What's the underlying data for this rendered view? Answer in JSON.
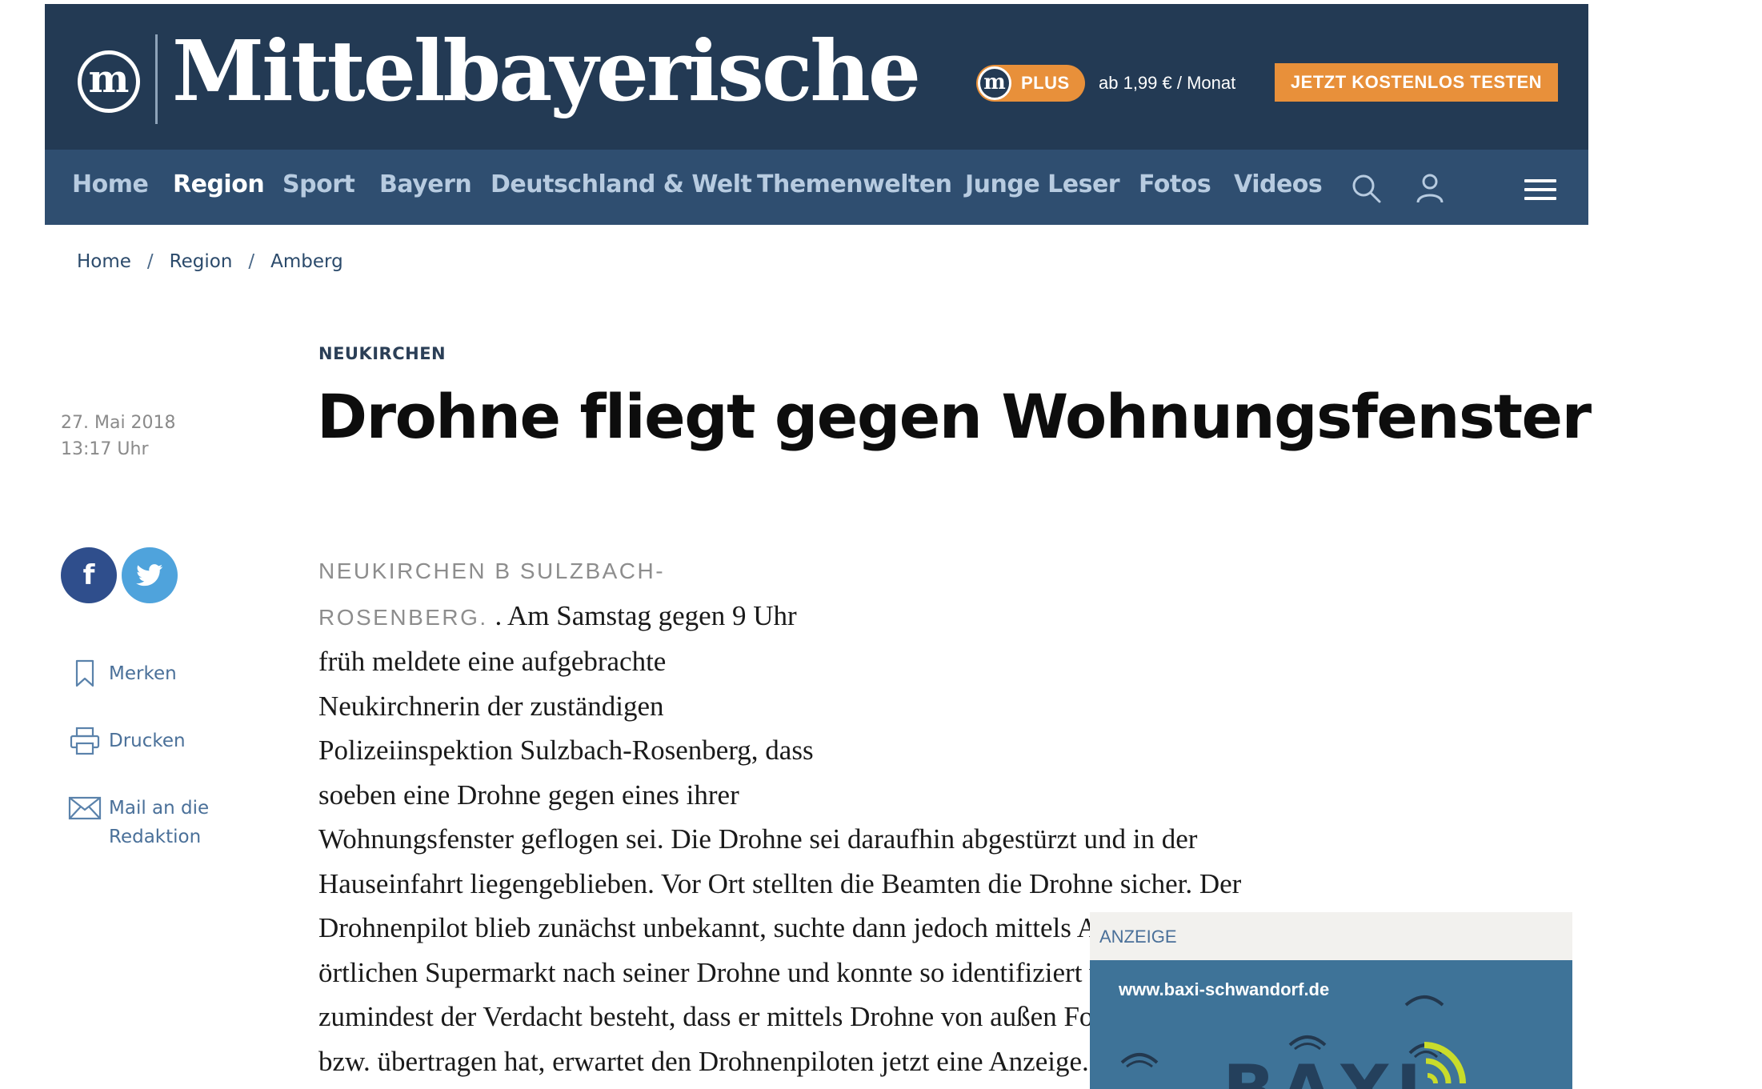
{
  "header": {
    "logo_letter": "m",
    "site_name": "Mittelbayerische",
    "plus": {
      "logo_letter": "m",
      "label": "PLUS"
    },
    "price": "ab 1,99 € / Monat",
    "cta_label": "JETZT KOSTENLOS TESTEN",
    "colors": {
      "brand_bar": "#233a54",
      "nav_bar": "#2f4e70",
      "accent": "#e8903a"
    }
  },
  "nav": {
    "items": [
      {
        "label": "Home"
      },
      {
        "label": "Region",
        "active": true
      },
      {
        "label": "Sport"
      },
      {
        "label": "Bayern"
      },
      {
        "label": "Deutschland & Welt"
      },
      {
        "label": "Themenwelten"
      },
      {
        "label": "Junge Leser"
      },
      {
        "label": "Fotos"
      },
      {
        "label": "Videos"
      }
    ],
    "icons": [
      "search-icon",
      "user-icon",
      "menu-icon"
    ]
  },
  "breadcrumb": {
    "items": [
      "Home",
      "Region",
      "Amberg"
    ],
    "separator": "/"
  },
  "meta": {
    "date": "27. Mai 2018",
    "time": "13:17 Uhr"
  },
  "share": {
    "facebook_glyph": "f",
    "icons": [
      "facebook-icon",
      "twitter-icon"
    ]
  },
  "tools": {
    "bookmark": "Merken",
    "print": "Drucken",
    "mail_line1": "Mail an die",
    "mail_line2": "Redaktion"
  },
  "article": {
    "kicker": "NEUKIRCHEN",
    "headline": "Drohne fliegt gegen Wohnungsfenster",
    "dateline": "NEUKIRCHEN B SULZBACH-ROSENBERG.",
    "body": " . Am Samstag gegen 9 Uhr früh meldete eine aufgebrachte Neukirchnerin der zuständigen Polizeiinspektion Sulzbach-Rosenberg, dass soeben eine Drohne gegen eines ihrer Wohnungsfenster geflogen sei. Die Drohne sei daraufhin abgestürzt und in der Hauseinfahrt liegengeblieben. Vor Ort stellten die Beamten die Drohne sicher. Der Drohnenpilot blieb zunächst unbekannt, suchte dann jedoch mittels Aushang im örtlichen Supermarkt nach seiner Drohne und konnte so identifiziert werden. Da zumindest der Verdacht besteht, dass er mittels Drohne von außen Fotos aufgenommen bzw. übertragen hat, erwartet den Drohnenpiloten jetzt eine Anzeige."
  },
  "ad": {
    "label": "ANZEIGE",
    "url": "www.baxi-schwandorf.de",
    "logo_text": "BAXI"
  }
}
